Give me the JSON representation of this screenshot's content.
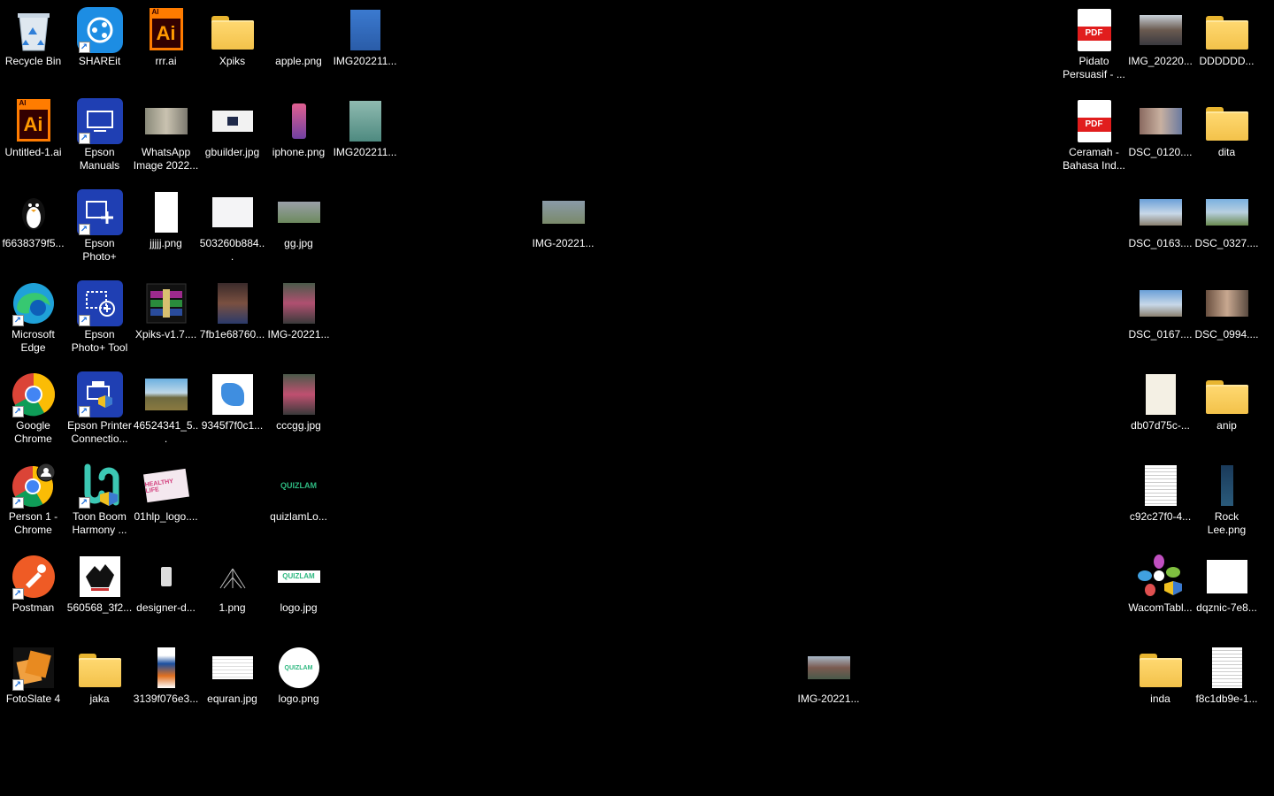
{
  "desktop": {
    "icons": [
      {
        "label": "Recycle Bin"
      },
      {
        "label": "SHAREit"
      },
      {
        "label": "rrr.ai"
      },
      {
        "label": "Xpiks"
      },
      {
        "label": "apple.png"
      },
      {
        "label": "IMG202211..."
      },
      {
        "label": "Untitled-1.ai"
      },
      {
        "label": "Epson Manuals"
      },
      {
        "label": "WhatsApp Image 2022..."
      },
      {
        "label": "gbuilder.jpg"
      },
      {
        "label": "iphone.png"
      },
      {
        "label": "IMG202211..."
      },
      {
        "label": "f6638379f5..."
      },
      {
        "label": "Epson Photo+"
      },
      {
        "label": "jjjjj.png"
      },
      {
        "label": "503260b884..."
      },
      {
        "label": "gg.jpg"
      },
      {
        "label": "Microsoft Edge"
      },
      {
        "label": "Epson Photo+ Tool"
      },
      {
        "label": "Xpiks-v1.7...."
      },
      {
        "label": "7fb1e68760..."
      },
      {
        "label": "IMG-20221..."
      },
      {
        "label": "Google Chrome"
      },
      {
        "label": "Epson Printer Connectio..."
      },
      {
        "label": "46524341_5..."
      },
      {
        "label": "9345f7f0c1..."
      },
      {
        "label": "cccgg.jpg"
      },
      {
        "label": "Person 1 - Chrome"
      },
      {
        "label": "Toon Boom Harmony ..."
      },
      {
        "label": "01hlp_logo...."
      },
      {
        "label": "quizlamLo..."
      },
      {
        "label": "Postman"
      },
      {
        "label": "560568_3f2..."
      },
      {
        "label": "designer-d..."
      },
      {
        "label": "1.png"
      },
      {
        "label": "logo.jpg"
      },
      {
        "label": "FotoSlate 4"
      },
      {
        "label": "jaka"
      },
      {
        "label": "3139f076e3..."
      },
      {
        "label": "equran.jpg"
      },
      {
        "label": "logo.png"
      },
      {
        "label": "IMG-20221..."
      },
      {
        "label": "IMG-20221..."
      },
      {
        "label": "Pidato Persuasif - ..."
      },
      {
        "label": "IMG_20220..."
      },
      {
        "label": "DDDDDD..."
      },
      {
        "label": "Ceramah - Bahasa Ind..."
      },
      {
        "label": "DSC_0120...."
      },
      {
        "label": "dita"
      },
      {
        "label": "DSC_0163...."
      },
      {
        "label": "DSC_0327...."
      },
      {
        "label": "DSC_0167...."
      },
      {
        "label": "DSC_0994...."
      },
      {
        "label": "db07d75c-..."
      },
      {
        "label": "anip"
      },
      {
        "label": "c92c27f0-4..."
      },
      {
        "label": "Rock Lee.png"
      },
      {
        "label": "WacomTabl..."
      },
      {
        "label": "dqznic-7e8..."
      },
      {
        "label": "inda"
      },
      {
        "label": "f8c1db9e-1..."
      }
    ]
  },
  "glyphs": {
    "ai_text": "Ai",
    "ai_badge": "AI",
    "pdf_text": "PDF",
    "quizlam_text": "QUIZLAM",
    "healthy_text": "HEALTHY LIFE",
    "shortcut_arrow": "↗"
  }
}
